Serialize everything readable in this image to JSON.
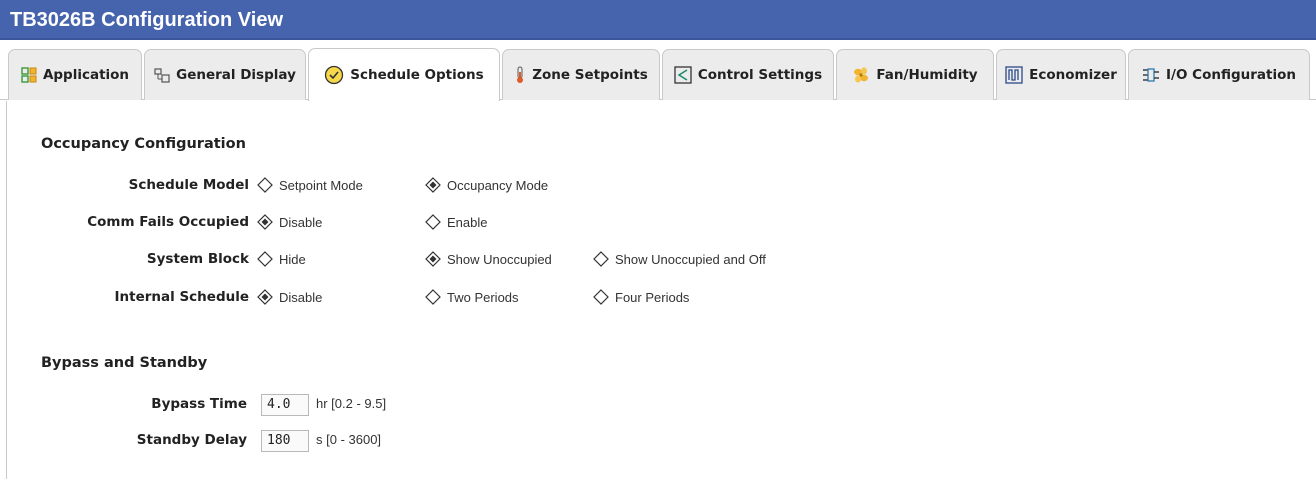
{
  "window": {
    "title": "TB3026B Configuration View"
  },
  "tabs": [
    {
      "label": "Application",
      "icon": "application-icon",
      "active": false
    },
    {
      "label": "General Display",
      "icon": "general-display-icon",
      "active": false
    },
    {
      "label": "Schedule Options",
      "icon": "schedule-clock-icon",
      "active": true
    },
    {
      "label": "Zone Setpoints",
      "icon": "thermometer-icon",
      "active": false
    },
    {
      "label": "Control Settings",
      "icon": "control-settings-icon",
      "active": false
    },
    {
      "label": "Fan/Humidity",
      "icon": "fan-icon",
      "active": false
    },
    {
      "label": "Economizer",
      "icon": "economizer-icon",
      "active": false
    },
    {
      "label": "I/O Configuration",
      "icon": "io-configuration-icon",
      "active": false
    }
  ],
  "occupancy": {
    "title": "Occupancy Configuration",
    "rows": [
      {
        "label": "Schedule Model",
        "options": [
          "Setpoint Mode",
          "Occupancy Mode"
        ],
        "selected": 1
      },
      {
        "label": "Comm Fails Occupied",
        "options": [
          "Disable",
          "Enable"
        ],
        "selected": 0
      },
      {
        "label": "System Block",
        "options": [
          "Hide",
          "Show Unoccupied",
          "Show Unoccupied and Off"
        ],
        "selected": 1
      },
      {
        "label": "Internal Schedule",
        "options": [
          "Disable",
          "Two Periods",
          "Four Periods"
        ],
        "selected": 0
      }
    ]
  },
  "bypass": {
    "title": "Bypass and Standby",
    "bypass_time": {
      "label": "Bypass Time",
      "value": "4.0",
      "unit": "hr [0.2 - 9.5]"
    },
    "standby_delay": {
      "label": "Standby Delay",
      "value": "180",
      "unit": "s [0 - 3600]"
    }
  },
  "colors": {
    "title_bar": "#4664ad",
    "tab_inactive": "#ececec",
    "tab_active": "#ffffff"
  }
}
